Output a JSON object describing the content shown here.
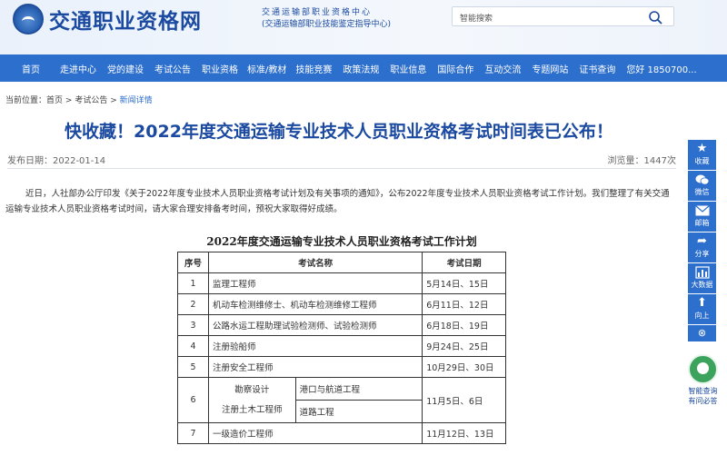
{
  "header": {
    "site_title": "交通职业资格网",
    "org_line1": "交通运输部职业资格中心",
    "org_line2": "(交通运输部职业技能鉴定指导中心)",
    "search_placeholder": "智能搜索"
  },
  "nav": {
    "items": [
      "首页",
      "走进中心",
      "党的建设",
      "考试公告",
      "职业资格",
      "标准/教材",
      "技能竞赛",
      "政策法规",
      "职业信息",
      "国际合作",
      "互动交流",
      "专题网站",
      "证书查询",
      "您好  1850700..."
    ]
  },
  "breadcrumb": {
    "prefix": "当前位置：",
    "home": "首页",
    "sep1": ">",
    "section": "考试公告",
    "sep2": ">",
    "current": "新闻详情"
  },
  "article": {
    "title": "快收藏！2022年度交通运输专业技术人员职业资格考试时间表已公布！",
    "date_label": "发布日期：2022-01-14",
    "views_label": "浏览量：1447次",
    "intro": "近日，人社部办公厅印发《关于2022年度专业技术人员职业资格考试计划及有关事项的通知》，公布2022年度专业技术人员职业资格考试工作计划。我们整理了有关交通运输专业技术人员职业资格考试时间，请大家合理安排备考时间，预祝大家取得好成绩。"
  },
  "plan_table": {
    "title": "2022年度交通运输专业技术人员职业资格考试工作计划",
    "headers": [
      "序号",
      "考试名称",
      "考试日期"
    ],
    "rows": [
      {
        "no": "1",
        "name": "监理工程师",
        "date": "5月14日、15日"
      },
      {
        "no": "2",
        "name": "机动车检测维修士、机动车检测维修工程师",
        "date": "6月11日、12日"
      },
      {
        "no": "3",
        "name": "公路水运工程助理试验检测师、试验检测师",
        "date": "6月18日、19日"
      },
      {
        "no": "4",
        "name": "注册验船师",
        "date": "9月24日、25日"
      },
      {
        "no": "5",
        "name": "注册安全工程师",
        "date": "10月29日、30日"
      }
    ],
    "row6": {
      "no": "6",
      "cat1": "勘察设计",
      "cat2": "注册土木工程师",
      "sub1": "港口与航道工程",
      "sub2": "道路工程",
      "date": "11月5日、6日"
    },
    "row7": {
      "no": "7",
      "name": "一级造价工程师",
      "date": "11月12日、13日"
    }
  },
  "sidebar": {
    "items": [
      {
        "label": "收藏",
        "icon": "star-icon"
      },
      {
        "label": "微信",
        "icon": "wechat-icon"
      },
      {
        "label": "邮箱",
        "icon": "mail-icon"
      },
      {
        "label": "分享",
        "icon": "share-icon"
      },
      {
        "label": "大数据",
        "icon": "chart-icon"
      },
      {
        "label": "向上",
        "icon": "arrow-up-icon"
      }
    ],
    "close_glyph": "⊗",
    "assistant_line1": "智能查询",
    "assistant_line2": "有问必答"
  },
  "colors": {
    "brand": "#1b4aa0",
    "nav_bg": "#2d6fcd",
    "assistant": "#3ba35b"
  }
}
